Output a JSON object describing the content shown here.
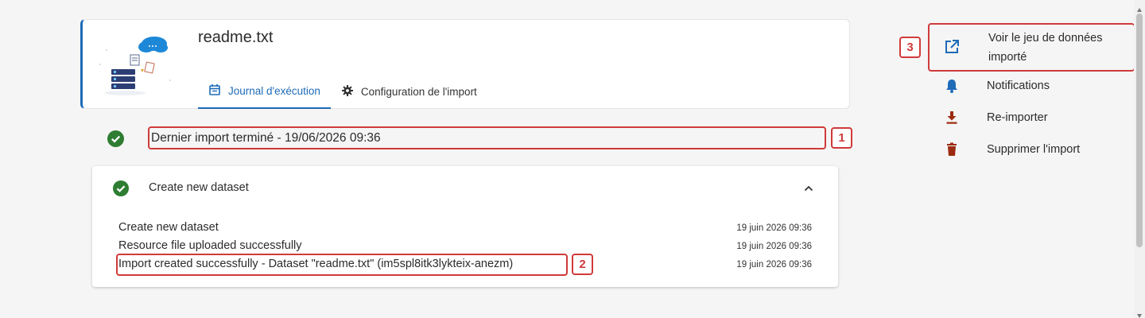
{
  "header": {
    "file_name": "readme.txt",
    "tabs": [
      {
        "label": "Journal d'exécution",
        "active": true
      },
      {
        "label": "Configuration de l'import",
        "active": false
      }
    ]
  },
  "status": {
    "text": "Dernier import terminé - 19/06/2026 09:36",
    "badge": "1"
  },
  "panel": {
    "title": "Create new dataset",
    "logs": [
      {
        "message": "Create new dataset",
        "date": "19 juin 2026 09:36"
      },
      {
        "message": "Resource file uploaded successfully",
        "date": "19 juin 2026 09:36"
      },
      {
        "message": "Import created successfully - Dataset \"readme.txt\" (im5spl8itk3lykteix-anezm)",
        "date": "19 juin 2026 09:36"
      }
    ],
    "badge": "2"
  },
  "actions": {
    "view_dataset": "Voir le jeu de données importé",
    "notifications": "Notifications",
    "reimport": "Re-importer",
    "delete": "Supprimer l'import",
    "badge": "3"
  },
  "colors": {
    "primary": "#1e6bb8",
    "success": "#2e7d32",
    "highlight": "#d03a3a",
    "danger": "#9c2a10"
  }
}
